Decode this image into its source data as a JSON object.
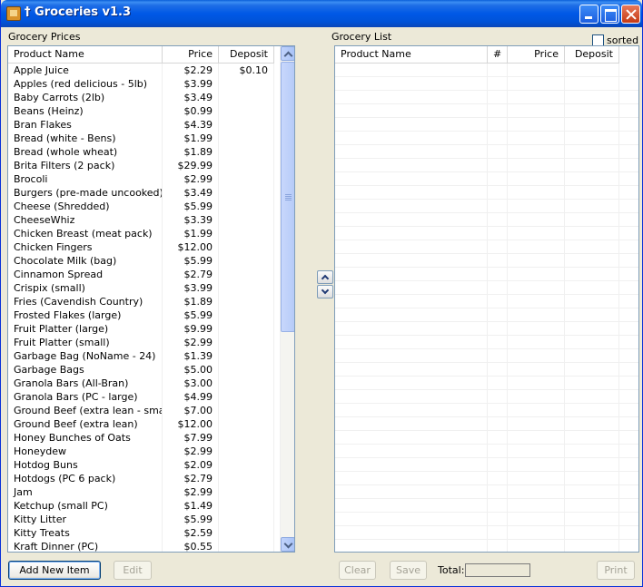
{
  "window": {
    "title": "† Groceries v1.3"
  },
  "prices": {
    "label": "Grocery Prices",
    "headers": [
      "Product Name",
      "Price",
      "Deposit"
    ],
    "rows": [
      [
        "Apple Juice",
        "$2.29",
        "$0.10"
      ],
      [
        "Apples (red delicious - 5lb)",
        "$3.99",
        ""
      ],
      [
        "Baby Carrots (2lb)",
        "$3.49",
        ""
      ],
      [
        "Beans (Heinz)",
        "$0.99",
        ""
      ],
      [
        "Bran Flakes",
        "$4.39",
        ""
      ],
      [
        "Bread (white - Bens)",
        "$1.99",
        ""
      ],
      [
        "Bread (whole wheat)",
        "$1.89",
        ""
      ],
      [
        "Brita Filters (2 pack)",
        "$29.99",
        ""
      ],
      [
        "Brocoli",
        "$2.99",
        ""
      ],
      [
        "Burgers (pre-made uncooked)",
        "$3.49",
        ""
      ],
      [
        "Cheese (Shredded)",
        "$5.99",
        ""
      ],
      [
        "CheeseWhiz",
        "$3.39",
        ""
      ],
      [
        "Chicken Breast (meat pack)",
        "$1.99",
        ""
      ],
      [
        "Chicken Fingers",
        "$12.00",
        ""
      ],
      [
        "Chocolate Milk (bag)",
        "$5.99",
        ""
      ],
      [
        "Cinnamon Spread",
        "$2.79",
        ""
      ],
      [
        "Crispix (small)",
        "$3.99",
        ""
      ],
      [
        "Fries (Cavendish Country)",
        "$1.89",
        ""
      ],
      [
        "Frosted Flakes (large)",
        "$5.99",
        ""
      ],
      [
        "Fruit Platter (large)",
        "$9.99",
        ""
      ],
      [
        "Fruit Platter (small)",
        "$2.99",
        ""
      ],
      [
        "Garbage Bag (NoName - 24)",
        "$1.39",
        ""
      ],
      [
        "Garbage Bags",
        "$5.00",
        ""
      ],
      [
        "Granola Bars (All-Bran)",
        "$3.00",
        ""
      ],
      [
        "Granola Bars (PC - large)",
        "$4.99",
        ""
      ],
      [
        "Ground Beef (extra lean - small)",
        "$7.00",
        ""
      ],
      [
        "Ground Beef (extra lean)",
        "$12.00",
        ""
      ],
      [
        "Honey Bunches of Oats",
        "$7.99",
        ""
      ],
      [
        "Honeydew",
        "$2.99",
        ""
      ],
      [
        "Hotdog Buns",
        "$2.09",
        ""
      ],
      [
        "Hotdogs (PC 6 pack)",
        "$2.79",
        ""
      ],
      [
        "Jam",
        "$2.99",
        ""
      ],
      [
        "Ketchup (small PC)",
        "$1.49",
        ""
      ],
      [
        "Kitty Litter",
        "$5.99",
        ""
      ],
      [
        "Kitty Treats",
        "$2.59",
        ""
      ],
      [
        "Kraft Dinner (PC)",
        "$0.55",
        ""
      ]
    ]
  },
  "list": {
    "label": "Grocery List",
    "headers": [
      "Product Name",
      "#",
      "Price",
      "Deposit"
    ],
    "sorted_label": "sorted",
    "sorted_checked": false
  },
  "buttons": {
    "add": "Add New Item",
    "edit": "Edit",
    "clear": "Clear",
    "save": "Save",
    "print": "Print"
  },
  "total": {
    "label": "Total:",
    "value": ""
  }
}
